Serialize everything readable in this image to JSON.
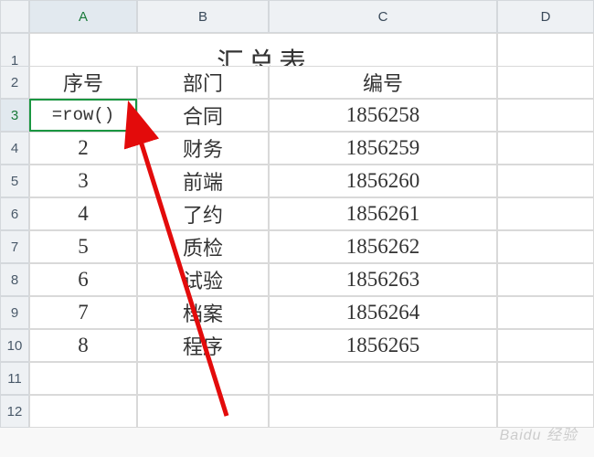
{
  "columns": [
    "A",
    "B",
    "C",
    "D"
  ],
  "rowHeaders": [
    "1",
    "2",
    "3",
    "4",
    "5",
    "6",
    "7",
    "8",
    "9",
    "10",
    "11",
    "12"
  ],
  "title": "汇总表",
  "headers": {
    "colA": "序号",
    "colB": "部门",
    "colC": "编号"
  },
  "activeCell": {
    "ref": "A3",
    "formula": "=row()"
  },
  "rows": [
    {
      "seq": "=row()",
      "dept": "合同",
      "code": "1856258"
    },
    {
      "seq": "2",
      "dept": "财务",
      "code": "1856259"
    },
    {
      "seq": "3",
      "dept": "前端",
      "code": "1856260"
    },
    {
      "seq": "4",
      "dept": "了约",
      "code": "1856261"
    },
    {
      "seq": "5",
      "dept": "质检",
      "code": "1856262"
    },
    {
      "seq": "6",
      "dept": "试验",
      "code": "1856263"
    },
    {
      "seq": "7",
      "dept": "档案",
      "code": "1856264"
    },
    {
      "seq": "8",
      "dept": "程序",
      "code": "1856265"
    }
  ],
  "watermark": "Baidu 经验",
  "annotation": {
    "type": "arrow",
    "color": "#e30b0b"
  }
}
